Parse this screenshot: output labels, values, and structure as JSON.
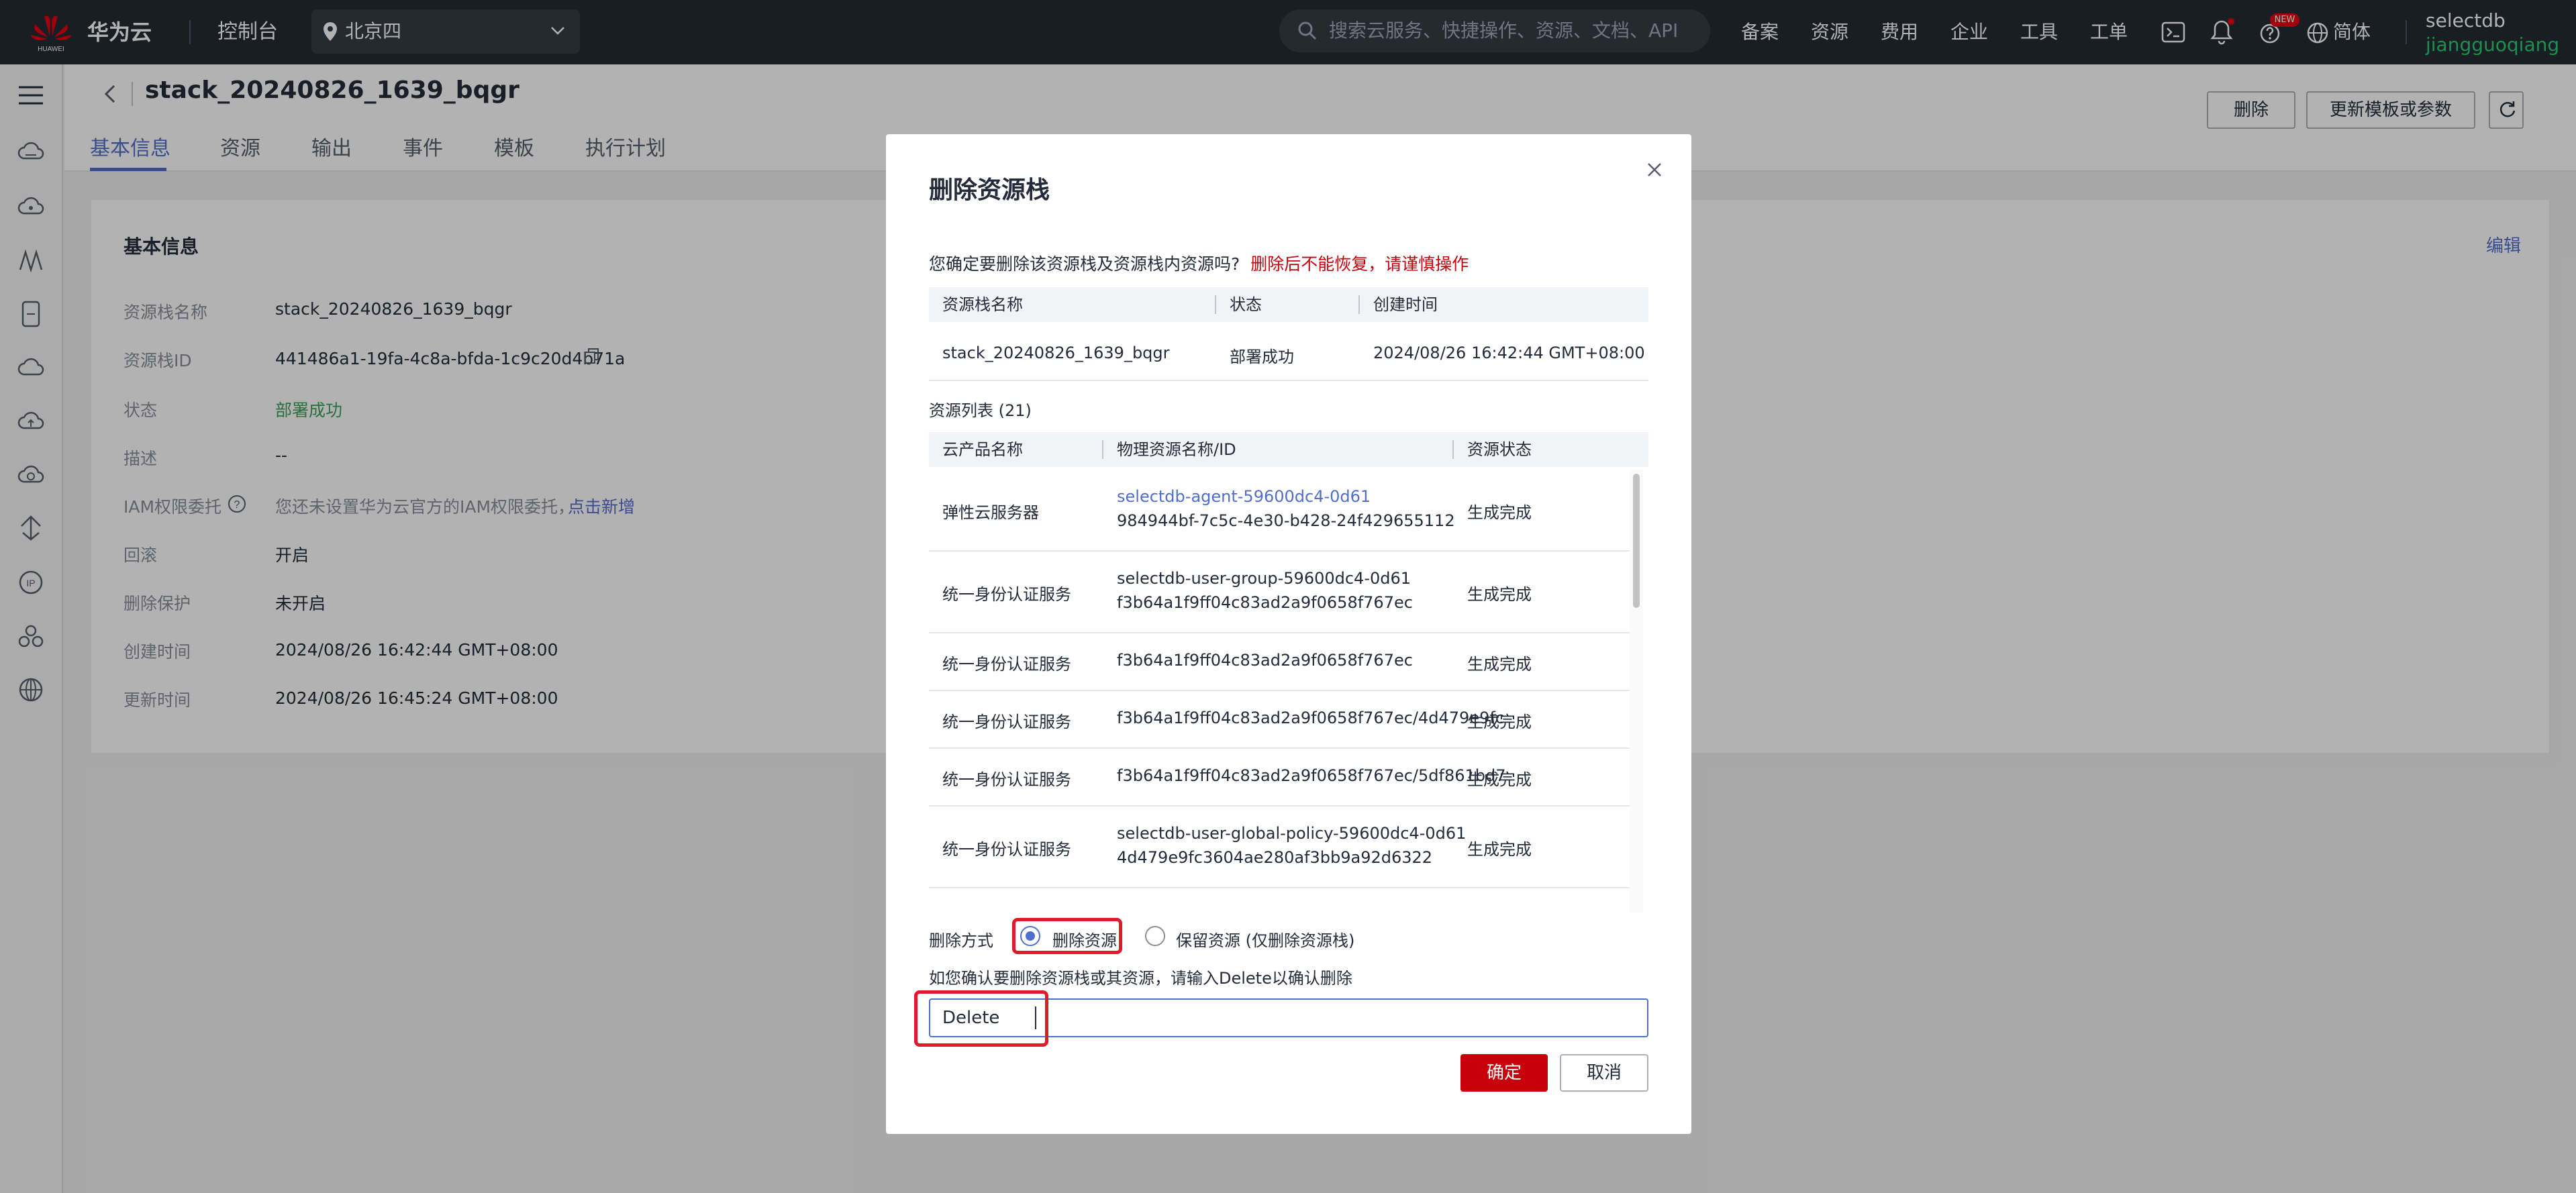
{
  "topbar": {
    "brand": "华为云",
    "console": "控制台",
    "region": "北京四",
    "search_placeholder": "搜索云服务、快捷操作、资源、文档、API",
    "nav": [
      "备案",
      "资源",
      "费用",
      "企业",
      "工具",
      "工单"
    ],
    "lang": "简体",
    "new_badge": "NEW",
    "user_account": "selectdb",
    "user_name": "jiangguoqiang",
    "logo_text": "HUAWEI"
  },
  "page": {
    "title": "stack_20240826_1639_bqgr",
    "tabs": [
      "基本信息",
      "资源",
      "输出",
      "事件",
      "模板",
      "执行计划"
    ],
    "delete_btn": "删除",
    "update_btn": "更新模板或参数"
  },
  "basic_info": {
    "title": "基本信息",
    "edit": "编辑",
    "fields": [
      {
        "label": "资源栈名称",
        "value": "stack_20240826_1639_bqgr"
      },
      {
        "label": "资源栈ID",
        "value": "441486a1-19fa-4c8a-bfda-1c9c20d4b71a"
      },
      {
        "label": "状态",
        "value": "部署成功"
      },
      {
        "label": "描述",
        "value": "--"
      },
      {
        "label": "IAM权限委托",
        "value": "您还未设置华为云官方的IAM权限委托，",
        "link": "点击新增"
      },
      {
        "label": "回滚",
        "value": "开启"
      },
      {
        "label": "删除保护",
        "value": "未开启"
      },
      {
        "label": "创建时间",
        "value": "2024/08/26 16:42:44 GMT+08:00"
      },
      {
        "label": "更新时间",
        "value": "2024/08/26 16:45:24 GMT+08:00"
      }
    ]
  },
  "modal": {
    "title": "删除资源栈",
    "desc": "您确定要删除该资源栈及资源栈内资源吗?",
    "warn": "删除后不能恢复，请谨慎操作",
    "stack_table": {
      "headers": [
        "资源栈名称",
        "状态",
        "创建时间"
      ],
      "row": [
        "stack_20240826_1639_bqgr",
        "部署成功",
        "2024/08/26 16:42:44 GMT+08:00"
      ]
    },
    "resource_list_label": "资源列表 (21)",
    "resource_table": {
      "headers": [
        "云产品名称",
        "物理资源名称/ID",
        "资源状态"
      ],
      "rows": [
        {
          "product": "弹性云服务器",
          "name": "selectdb-agent-59600dc4-0d61",
          "id": "984944bf-7c5c-4e30-b428-24f429655112",
          "status": "生成完成"
        },
        {
          "product": "统一身份认证服务",
          "name": "selectdb-user-group-59600dc4-0d61",
          "id": "f3b64a1f9ff04c83ad2a9f0658f767ec",
          "status": "生成完成"
        },
        {
          "product": "统一身份认证服务",
          "name": "f3b64a1f9ff04c83ad2a9f0658f767ec",
          "id": "",
          "status": "生成完成"
        },
        {
          "product": "统一身份认证服务",
          "name": "f3b64a1f9ff04c83ad2a9f0658f767ec/4d479e9fc",
          "id": "",
          "status": "生成完成"
        },
        {
          "product": "统一身份认证服务",
          "name": "f3b64a1f9ff04c83ad2a9f0658f767ec/5df861bd7",
          "id": "",
          "status": "生成完成"
        },
        {
          "product": "统一身份认证服务",
          "name": "selectdb-user-global-policy-59600dc4-0d61",
          "id": "4d479e9fc3604ae280af3bb9a92d6322",
          "status": "生成完成"
        }
      ]
    },
    "delete_method_label": "删除方式",
    "option_delete": "删除资源",
    "option_keep": "保留资源 (仅删除资源栈)",
    "confirm_hint": "如您确认要删除资源栈或其资源，请输入Delete以确认删除",
    "confirm_value": "Delete",
    "ok": "确定",
    "cancel": "取消"
  }
}
